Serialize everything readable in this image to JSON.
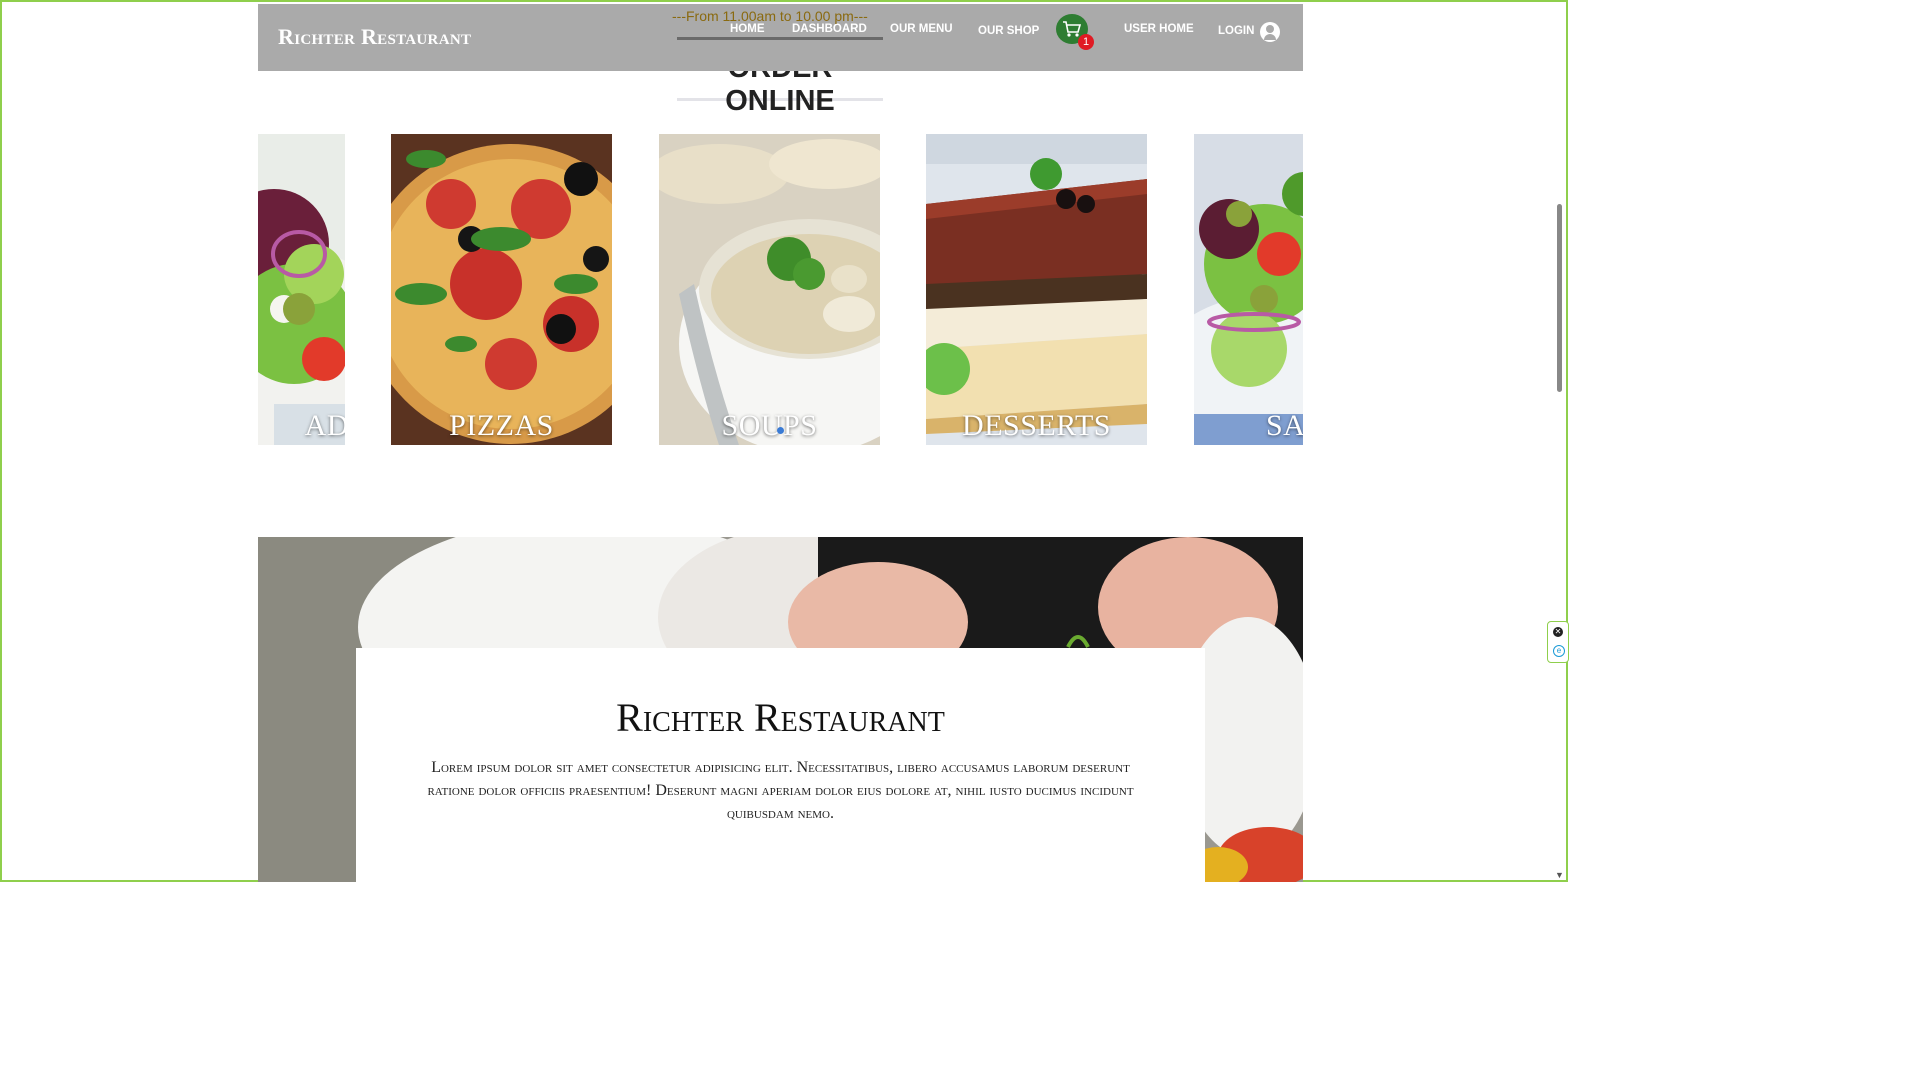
{
  "brand": "Richter Restaurant",
  "hours": "---From 11.00am to 10.00 pm---",
  "nav": {
    "home": "HOME",
    "dashboard": "DASHBOARD",
    "our_menu": "OUR MENU",
    "our_shop": "OUR SHOP",
    "cart_count": "1",
    "user_home": "USER HOME",
    "login": "LOGIN"
  },
  "section_title": "ORDER ONLINE",
  "carousel": {
    "items": [
      {
        "label": "AD"
      },
      {
        "label": "PIZZAS"
      },
      {
        "label": "SOUPS"
      },
      {
        "label": "DESSERTS"
      },
      {
        "label": "SA"
      }
    ]
  },
  "about": {
    "title": "Richter Restaurant",
    "text": "Lorem ipsum dolor sit amet consectetur adipisicing elit. Necessitatibus, libero accusamus laborum deserunt ratione dolor officiis praesentium! Deserunt magni aperiam dolor eius dolore at, nihil iusto ducimus incidunt quibusdam nemo."
  },
  "colors": {
    "navbar_bg": "#aaaaaa",
    "hours_text": "#8a6a10",
    "cart_bg": "#2e7d32",
    "badge_bg": "#e01b24",
    "frame_border": "#8fcf4c"
  },
  "icons": [
    "shopping-cart-icon",
    "user-account-icon",
    "close-icon",
    "extension-icon",
    "chevron-down-icon"
  ]
}
